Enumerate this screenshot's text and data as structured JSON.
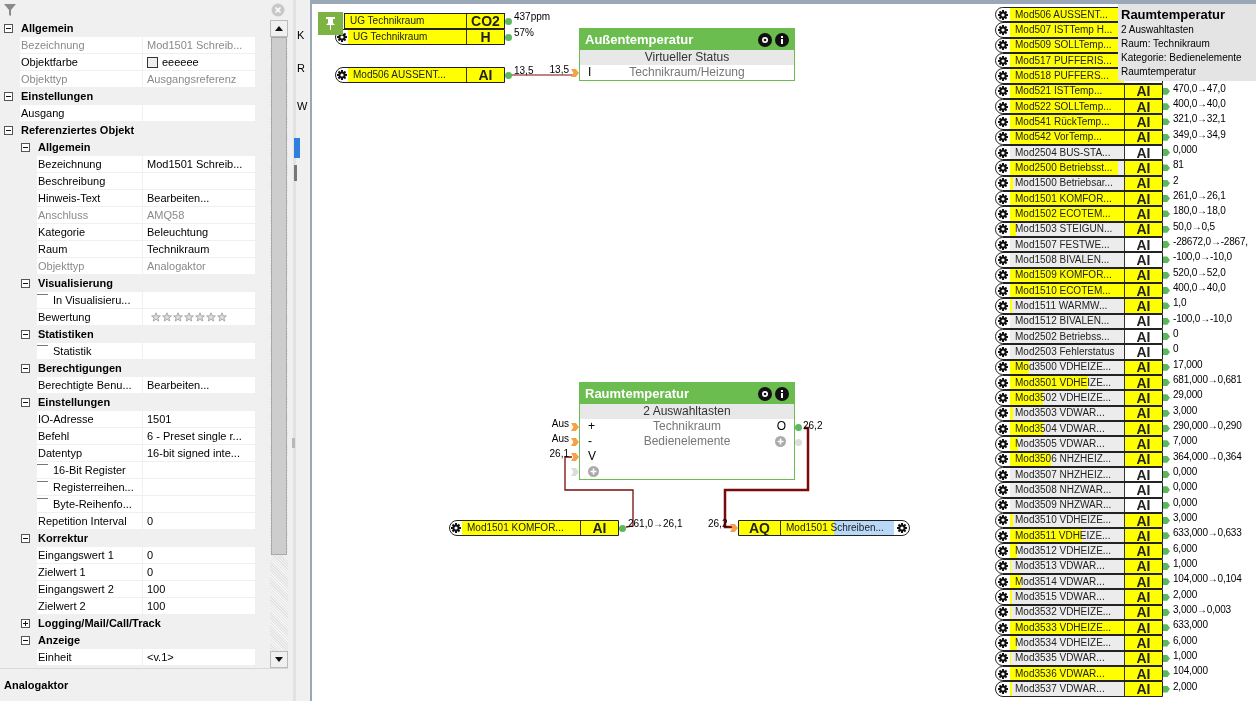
{
  "property_grid": [
    {
      "kind": "section",
      "label": "Allgemein",
      "expanded": true,
      "children": [
        {
          "kind": "property",
          "label": "Bezeichnung",
          "value": "Mod1501 Schreib...",
          "disabled": true
        },
        {
          "kind": "property",
          "label": "Objektfarbe",
          "value": "eeeeee",
          "color": "#eeeeee",
          "disabled": false
        },
        {
          "kind": "property",
          "label": "Objekttyp",
          "value": "Ausgangsreferenz",
          "disabled": true
        }
      ]
    },
    {
      "kind": "section",
      "label": "Einstellungen",
      "expanded": true,
      "children": [
        {
          "kind": "property",
          "label": "Ausgang",
          "disabled": false
        }
      ]
    },
    {
      "kind": "section",
      "label": "Referenziertes Objekt",
      "expanded": true,
      "children": [
        {
          "kind": "section",
          "label": "Allgemein",
          "expanded": true,
          "children": [
            {
              "kind": "property",
              "label": "Bezeichnung",
              "value": "Mod1501 Schreib...",
              "disabled": false
            },
            {
              "kind": "property",
              "label": "Beschreibung",
              "disabled": false
            },
            {
              "kind": "property",
              "label": "Hinweis-Text",
              "value": "Bearbeiten...",
              "disabled": false
            },
            {
              "kind": "property",
              "label": "Anschluss",
              "value": "AMQ58",
              "disabled": true
            },
            {
              "kind": "property",
              "label": "Kategorie",
              "value": "Beleuchtung",
              "disabled": false
            },
            {
              "kind": "property",
              "label": "Raum",
              "value": "Technikraum",
              "disabled": false
            },
            {
              "kind": "property",
              "label": "Objekttyp",
              "value": "Analogaktor",
              "disabled": true
            }
          ]
        },
        {
          "kind": "section",
          "label": "Visualisierung",
          "expanded": true,
          "children": [
            {
              "kind": "checkbox",
              "label": "In Visualisieru...",
              "checked": false
            },
            {
              "kind": "rating",
              "label": "Bewertung",
              "stars": 0
            }
          ]
        },
        {
          "kind": "section",
          "label": "Statistiken",
          "expanded": true,
          "children": [
            {
              "kind": "checkbox",
              "label": "Statistik",
              "checked": false
            }
          ]
        },
        {
          "kind": "section",
          "label": "Berechtigungen",
          "expanded": true,
          "children": [
            {
              "kind": "property",
              "label": "Berechtigte Benu...",
              "value": "Bearbeiten...",
              "disabled": false
            }
          ]
        },
        {
          "kind": "section",
          "label": "Einstellungen",
          "expanded": true,
          "children": [
            {
              "kind": "property",
              "label": "IO-Adresse",
              "value": "1501",
              "disabled": false
            },
            {
              "kind": "property",
              "label": "Befehl",
              "value": "6 - Preset single r...",
              "disabled": false
            },
            {
              "kind": "property",
              "label": "Datentyp",
              "value": "16-bit signed inte...",
              "disabled": false
            },
            {
              "kind": "checkbox",
              "label": "16-Bit Register",
              "checked": false
            },
            {
              "kind": "checkbox",
              "label": "Registerreihen...",
              "checked": false
            },
            {
              "kind": "checkbox",
              "label": "Byte-Reihenfo...",
              "checked": false
            },
            {
              "kind": "property",
              "label": "Repetition Interval",
              "value": "0",
              "disabled": false
            }
          ]
        },
        {
          "kind": "section",
          "label": "Korrektur",
          "expanded": true,
          "children": [
            {
              "kind": "property",
              "label": "Eingangswert 1",
              "value": "0",
              "disabled": false
            },
            {
              "kind": "property",
              "label": "Zielwert 1",
              "value": "0",
              "disabled": false
            },
            {
              "kind": "property",
              "label": "Eingangswert 2",
              "value": "100",
              "disabled": false
            },
            {
              "kind": "property",
              "label": "Zielwert 2",
              "value": "100",
              "disabled": false
            }
          ]
        },
        {
          "kind": "section",
          "label": "Logging/Mail/Call/Track",
          "expanded": false
        },
        {
          "kind": "section",
          "label": "Anzeige",
          "expanded": true,
          "children": [
            {
              "kind": "property",
              "label": "Einheit",
              "value": "<v.1>",
              "disabled": false
            }
          ]
        }
      ]
    }
  ],
  "description": {
    "title": "Analogaktor"
  },
  "side_strip": {
    "labels": [
      "K",
      "R",
      "W"
    ]
  },
  "canvas": {
    "input_refs": [
      {
        "name": "UG Technikraum",
        "badge": "CO2",
        "value": "437ppm",
        "level": 1
      },
      {
        "name": "UG Technikraum",
        "badge": "H",
        "value": "57%",
        "level": 1
      },
      {
        "name": "Mod506 AUSSENT...",
        "badge": "AI",
        "value": "13,5",
        "level": 1
      },
      {
        "name": "Mod1501 KOMFOR...",
        "badge": "AI",
        "value": "261,0→26,1",
        "level": 1
      }
    ],
    "output_refs": [
      {
        "input_value": "26,2",
        "badge": "AQ",
        "name": "Mod1501 Schreiben...",
        "level": 0.47,
        "selected": true
      }
    ],
    "blocks": [
      {
        "title": "Außentemperatur",
        "subtitle": "Virtueller Status",
        "add_slots": false,
        "inputs": [
          {
            "label": "I",
            "value": "13,5"
          }
        ],
        "center_lines": [
          "Technikraum/Heizung"
        ]
      },
      {
        "title": "Raumtemperatur",
        "subtitle": "2 Auswahltasten",
        "add_slots": true,
        "inputs": [
          {
            "label": "+",
            "value": "Aus"
          },
          {
            "label": "-",
            "value": "Aus"
          },
          {
            "label": "V",
            "value": "26,1"
          }
        ],
        "center_lines": [
          "Technikraum",
          "Bedienelemente"
        ],
        "outputs": [
          {
            "label": "O",
            "value": "26,2"
          }
        ]
      }
    ],
    "object_list": [
      {
        "name": "Mod506 AUSSENT...",
        "level": 1
      },
      {
        "name": "Mod507 ISTTemp H...",
        "level": 1
      },
      {
        "name": "Mod509 SOLLTemp...",
        "level": 1
      },
      {
        "name": "Mod517 PUFFERIS...",
        "level": 1
      },
      {
        "name": "Mod518 PUFFERS...",
        "level": 1
      },
      {
        "name": "Mod521 ISTTemp...",
        "level": 1,
        "badge": "AI",
        "badge_highlighted": true,
        "value": "470,0→47,0"
      },
      {
        "name": "Mod522 SOLLTemp...",
        "level": 1,
        "badge": "AI",
        "badge_highlighted": true,
        "value": "400,0→40,0"
      },
      {
        "name": "Mod541 RückTemp...",
        "level": 1,
        "badge": "AI",
        "badge_highlighted": true,
        "value": "321,0→32,1"
      },
      {
        "name": "Mod542 VorTemp...",
        "level": 1,
        "badge": "AI",
        "badge_highlighted": true,
        "value": "349,0→34,9"
      },
      {
        "name": "Mod2504 BUS-STA...",
        "level": 0,
        "badge": "AI",
        "badge_highlighted": false,
        "value": "0,000"
      },
      {
        "name": "Mod2500 Betriebsst...",
        "level": 0.95,
        "badge": "AI",
        "badge_highlighted": true,
        "value": "81"
      },
      {
        "name": "Mod1500 Betriebsar...",
        "level": 0.03,
        "badge": "AI",
        "badge_highlighted": true,
        "value": "2"
      },
      {
        "name": "Mod1501 KOMFOR...",
        "level": 1,
        "badge": "AI",
        "badge_highlighted": true,
        "value": "261,0→26,1"
      },
      {
        "name": "Mod1502 ECOTEM...",
        "level": 1,
        "badge": "AI",
        "badge_highlighted": true,
        "value": "180,0→18,0"
      },
      {
        "name": "Mod1503 STEIGUN...",
        "level": 0.05,
        "badge": "AI",
        "badge_highlighted": true,
        "value": "50,0→0,5"
      },
      {
        "name": "Mod1507 FESTWE...",
        "level": 0,
        "badge": "AI",
        "badge_highlighted": false,
        "value": "-28672,0→-2867,"
      },
      {
        "name": "Mod1508 BIVALEN...",
        "level": 0,
        "badge": "AI",
        "badge_highlighted": false,
        "value": "-100,0→-10,0"
      },
      {
        "name": "Mod1509 KOMFOR...",
        "level": 1,
        "badge": "AI",
        "badge_highlighted": true,
        "value": "520,0→52,0"
      },
      {
        "name": "Mod1510 ECOTEM...",
        "level": 1,
        "badge": "AI",
        "badge_highlighted": true,
        "value": "400,0→40,0"
      },
      {
        "name": "Mod1511 WARMW...",
        "level": 0.02,
        "badge": "AI",
        "badge_highlighted": true,
        "value": "1,0"
      },
      {
        "name": "Mod1512 BIVALEN...",
        "level": 0,
        "badge": "AI",
        "badge_highlighted": false,
        "value": "-100,0→-10,0"
      },
      {
        "name": "Mod2502 Betriebss...",
        "level": 0,
        "badge": "AI",
        "badge_highlighted": false,
        "value": "0"
      },
      {
        "name": "Mod2503 Fehlerstatus",
        "level": 0,
        "badge": "AI",
        "badge_highlighted": false,
        "value": "0"
      },
      {
        "name": "Mod3500 VDHEIZE...",
        "level": 0.17,
        "badge": "AI",
        "badge_highlighted": true,
        "value": "17,000"
      },
      {
        "name": "Mod3501 VDHEIZE...",
        "level": 0.68,
        "badge": "AI",
        "badge_highlighted": true,
        "value": "681,000→0,681"
      },
      {
        "name": "Mod3502 VDHEIZE...",
        "level": 0.29,
        "badge": "AI",
        "badge_highlighted": true,
        "value": "29,000"
      },
      {
        "name": "Mod3503 VDWAR...",
        "level": 0.03,
        "badge": "AI",
        "badge_highlighted": true,
        "value": "3,000"
      },
      {
        "name": "Mod3504 VDWAR...",
        "level": 0.29,
        "badge": "AI",
        "badge_highlighted": true,
        "value": "290,000→0,290"
      },
      {
        "name": "Mod3505 VDWAR...",
        "level": 0.07,
        "badge": "AI",
        "badge_highlighted": true,
        "value": "7,000"
      },
      {
        "name": "Mod3506 NHZHEIZ...",
        "level": 0.36,
        "badge": "AI",
        "badge_highlighted": true,
        "value": "364,000→0,364"
      },
      {
        "name": "Mod3507 NHZHEIZ...",
        "level": 0,
        "badge": "AI",
        "badge_highlighted": false,
        "value": "0,000"
      },
      {
        "name": "Mod3508 NHZWAR...",
        "level": 0,
        "badge": "AI",
        "badge_highlighted": false,
        "value": "0,000"
      },
      {
        "name": "Mod3509 NHZWAR...",
        "level": 0,
        "badge": "AI",
        "badge_highlighted": false,
        "value": "0,000"
      },
      {
        "name": "Mod3510 VDHEIZE...",
        "level": 0.03,
        "badge": "AI",
        "badge_highlighted": true,
        "value": "3,000"
      },
      {
        "name": "Mod3511 VDHEIZE...",
        "level": 0.63,
        "badge": "AI",
        "badge_highlighted": true,
        "value": "633,000→0,633"
      },
      {
        "name": "Mod3512 VDHEIZE...",
        "level": 0.06,
        "badge": "AI",
        "badge_highlighted": true,
        "value": "6,000"
      },
      {
        "name": "Mod3513 VDWAR...",
        "level": 0.01,
        "badge": "AI",
        "badge_highlighted": true,
        "value": "1,000"
      },
      {
        "name": "Mod3514 VDWAR...",
        "level": 0.1,
        "badge": "AI",
        "badge_highlighted": true,
        "value": "104,000→0,104"
      },
      {
        "name": "Mod3515 VDWAR...",
        "level": 0.02,
        "badge": "AI",
        "badge_highlighted": true,
        "value": "2,000"
      },
      {
        "name": "Mod3532 VDHEIZE...",
        "level": 0.01,
        "badge": "AI",
        "badge_highlighted": true,
        "value": "3,000→0,003"
      },
      {
        "name": "Mod3533 VDHEIZE...",
        "level": 1,
        "badge": "AI",
        "badge_highlighted": true,
        "value": "633,000"
      },
      {
        "name": "Mod3534 VDHEIZE...",
        "level": 0.06,
        "badge": "AI",
        "badge_highlighted": true,
        "value": "6,000"
      },
      {
        "name": "Mod3535 VDWAR...",
        "level": 0.01,
        "badge": "AI",
        "badge_highlighted": true,
        "value": "1,000"
      },
      {
        "name": "Mod3536 VDWAR...",
        "level": 1,
        "badge": "AI",
        "badge_highlighted": true,
        "value": "104,000"
      },
      {
        "name": "Mod3537 VDWAR...",
        "level": 0.02,
        "badge": "AI",
        "badge_highlighted": true,
        "value": "2,000"
      }
    ],
    "tooltip": {
      "title": "Raumtemperatur",
      "lines": [
        "2 Auswahltasten",
        "Raum: Technikraum",
        "Kategorie: Bedienelemente",
        "Raumtemperatur"
      ]
    }
  }
}
